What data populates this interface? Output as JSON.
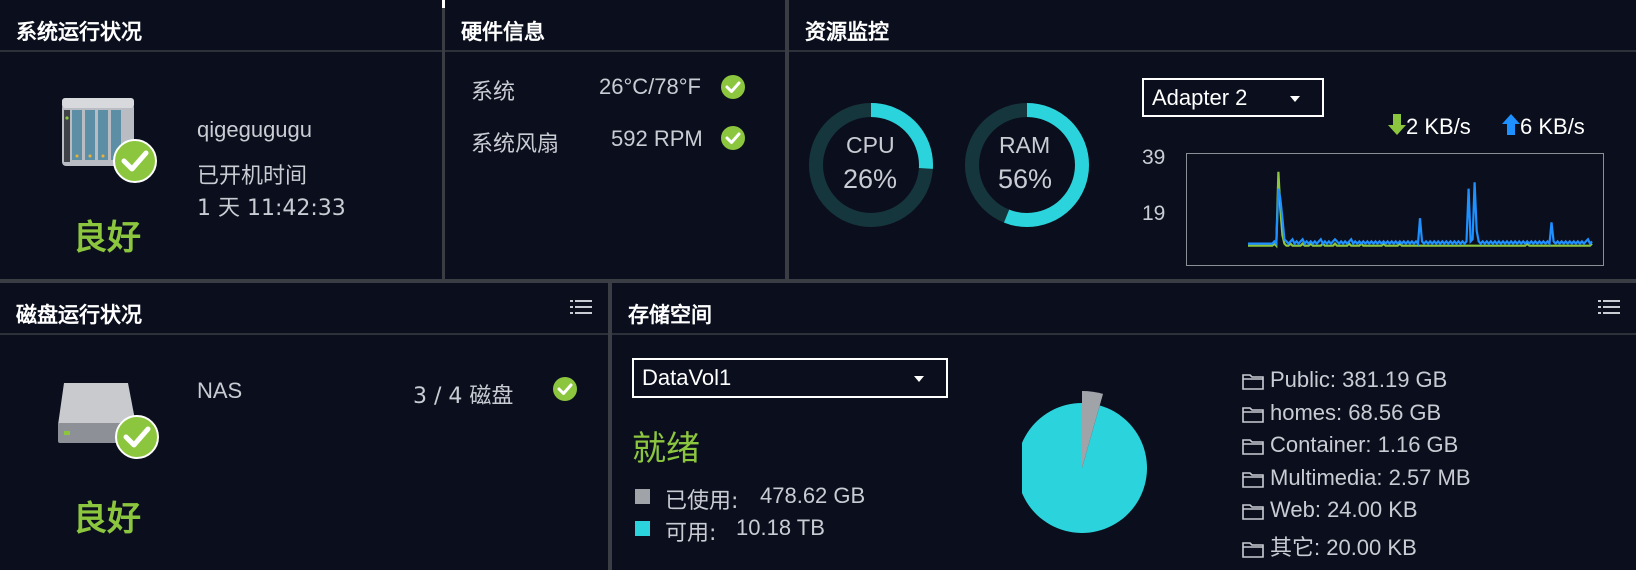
{
  "system_status": {
    "title": "系统运行状况",
    "hostname": "qigegugugu",
    "uptime_label": "已开机时间",
    "uptime_value": "1 天 11:42:33",
    "status": "良好"
  },
  "hardware": {
    "title": "硬件信息",
    "rows": [
      {
        "label": "系统",
        "value": "26°C/78°F"
      },
      {
        "label": "系统风扇",
        "value": "592 RPM"
      }
    ]
  },
  "resource_monitor": {
    "title": "资源监控",
    "cpu": {
      "label": "CPU",
      "value_text": "26%",
      "percent": 26
    },
    "ram": {
      "label": "RAM",
      "value_text": "56%",
      "percent": 56
    },
    "adapter": {
      "selected": "Adapter 2"
    },
    "download": "2 KB/s",
    "upload": "6 KB/s",
    "chart_data": {
      "type": "line",
      "y_ticks": [
        "39",
        "19"
      ],
      "ylim": [
        0,
        45
      ],
      "series": [
        {
          "color": "#8cc63f",
          "values": [
            3,
            3,
            3,
            3,
            3,
            3,
            3,
            3,
            3,
            3,
            3,
            3,
            3,
            4,
            3,
            38,
            20,
            8,
            4,
            3,
            3,
            4,
            3,
            3,
            3,
            3,
            3,
            4,
            3,
            3,
            3,
            4,
            3,
            3,
            3,
            3,
            3,
            4,
            3,
            3,
            3,
            3,
            3,
            4,
            3,
            3,
            3,
            3,
            3,
            3,
            4,
            3,
            3,
            3,
            3,
            3,
            4,
            3,
            3,
            3,
            3,
            3,
            3,
            3,
            3,
            3,
            3,
            4,
            3,
            3,
            3,
            3,
            3,
            3,
            3,
            4,
            3,
            3,
            3,
            3,
            3,
            3,
            3,
            3,
            3,
            3,
            3,
            3,
            3,
            3,
            3,
            3,
            3,
            3,
            3,
            3,
            3,
            3,
            3,
            3,
            3,
            3,
            3,
            3,
            3,
            3,
            3,
            3,
            3,
            3,
            3,
            3,
            3,
            3,
            3,
            3,
            3,
            3,
            3,
            3,
            3,
            3,
            3,
            3,
            3,
            3,
            3,
            3,
            3,
            3,
            3,
            3,
            3,
            3,
            3,
            3,
            3,
            3,
            4,
            3,
            3,
            3,
            3,
            3,
            3,
            3,
            3,
            3,
            3,
            3,
            3,
            3,
            3,
            3,
            3,
            3,
            3,
            3,
            3,
            3,
            3,
            3,
            3,
            3,
            3,
            3,
            3,
            3,
            3,
            3,
            4
          ]
        },
        {
          "color": "#1e90ff",
          "values": [
            4,
            4,
            4,
            4,
            4,
            4,
            4,
            4,
            4,
            4,
            4,
            4,
            4,
            5,
            4,
            30,
            25,
            16,
            6,
            5,
            4,
            5,
            6,
            4,
            5,
            4,
            5,
            6,
            4,
            5,
            4,
            5,
            4,
            5,
            4,
            5,
            6,
            4,
            5,
            4,
            5,
            4,
            5,
            6,
            5,
            4,
            5,
            4,
            5,
            4,
            5,
            6,
            4,
            5,
            4,
            5,
            4,
            5,
            4,
            5,
            4,
            5,
            4,
            5,
            4,
            5,
            4,
            5,
            4,
            5,
            4,
            5,
            4,
            5,
            4,
            5,
            4,
            5,
            4,
            5,
            4,
            5,
            4,
            5,
            4,
            16,
            5,
            4,
            5,
            4,
            5,
            4,
            5,
            4,
            5,
            4,
            5,
            4,
            5,
            4,
            5,
            4,
            5,
            4,
            5,
            4,
            5,
            4,
            5,
            30,
            5,
            6,
            33,
            10,
            5,
            4,
            5,
            4,
            5,
            4,
            5,
            4,
            5,
            4,
            5,
            4,
            5,
            4,
            5,
            4,
            5,
            4,
            5,
            4,
            5,
            4,
            5,
            4,
            5,
            4,
            5,
            4,
            5,
            4,
            5,
            4,
            5,
            4,
            5,
            4,
            14,
            5,
            4,
            5,
            4,
            5,
            4,
            5,
            4,
            5,
            4,
            5,
            4,
            5,
            4,
            5,
            4,
            5,
            6,
            4,
            5
          ]
        }
      ]
    }
  },
  "disk_status": {
    "title": "磁盘运行状况",
    "name": "NAS",
    "count": "3 / 4 磁盘",
    "status": "良好"
  },
  "storage": {
    "title": "存储空间",
    "volume": "DataVol1",
    "state": "就绪",
    "used_label": "已使用:",
    "used_value": "478.62 GB",
    "free_label": "可用:",
    "free_value": "10.18 TB",
    "used_color": "#a0a3a8",
    "free_color": "#2bd4dc",
    "used_percent": 4.4,
    "folders": [
      "Public: 381.19 GB",
      "homes: 68.56 GB",
      "Container: 1.16 GB",
      "Multimedia: 2.57 MB",
      "Web: 24.00 KB",
      "其它: 20.00 KB"
    ]
  }
}
